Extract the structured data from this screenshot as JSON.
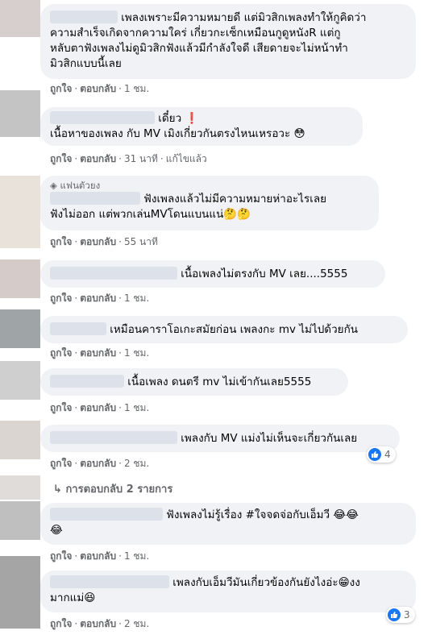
{
  "colors": {
    "bubble": "#f0f2f5",
    "meta_text": "#65676b",
    "like_blue": "#1877f2",
    "avatar_shades": [
      "#d7cfcd",
      "#c4c4c4",
      "#e9e2da",
      "#d5cbc8",
      "#9fa5a7",
      "#cfcfcf",
      "#dbd5d2",
      "#e0dcd9",
      "#bfbfbf",
      "#a5a5a5"
    ]
  },
  "labels": {
    "like": "ถูกใจ",
    "reply": "ตอบกลับ",
    "separator": "·",
    "fan_badge": "แฟนตัวยง",
    "view_replies": "การตอบกลับ 2 รายการ"
  },
  "comments": [
    {
      "lines": [
        "เพลงเพราะมีความหมายดี แต่มิวสิกเพลงทำให้กูคิดว่า",
        "ความสำเร็จเกิดจากความใคร่ เกี่ยวกะเซ็กเหมือนกูดูหนังR แต่กู",
        "หลับตาฟังเพลงไม่ดูมิวสิกฟังแล้วมีกำลังใจดี เสียดายจะไม่หน้าทำ",
        "มิวสิกแบบนี้เลย"
      ],
      "time": "1 ชม."
    },
    {
      "lines": [
        "เดี๋ยว ❗",
        "เนื้อหาของเพลง กับ MV เมิงเกี่ยวกันตรงไหนเหรอวะ 😳"
      ],
      "time": "31 นาที",
      "edited": "แก้ไขแล้ว"
    },
    {
      "lines": [
        "ฟังเพลงแล้วไม่มีความหมายห่าอะไรเลย",
        "ฟังไม่ออก แต่พวกเล่นMVโดนแบนแน่🤔🤔"
      ],
      "time": "55 นาที"
    },
    {
      "lines": [
        "เนื้อเพลงไม่ตรงกับ MV เลย....5555"
      ],
      "time": "1 ชม."
    },
    {
      "lines": [
        "เหมือนคาราโอเกะสมัยก่อน เพลงกะ mv ไม่ไปด้วยกัน"
      ],
      "time": "1 ชม."
    },
    {
      "lines": [
        "เนื้อเพลง ดนตรี mv ไม่เข้ากันเลย5555"
      ],
      "time": "1 ชม."
    },
    {
      "lines": [
        "เพลงกับ MV แม่งไม่เห็นจะเกี่ยวกันเลย"
      ],
      "time": "2 ชม.",
      "reactions": "4"
    },
    {
      "lines": [
        "ฟังเพลงไม่รู้เรื่อง #ใจจดจ่อกับเอ็มวี 😂😂",
        "😂"
      ],
      "time": "1 ชม."
    },
    {
      "lines": [
        "เพลงกับเอ็มวีมันเกี่ยวข้องกันยังไงอ่ะ😁งง",
        "มากแม่😆"
      ],
      "time": "2 ชม.",
      "reactions": "3"
    }
  ]
}
